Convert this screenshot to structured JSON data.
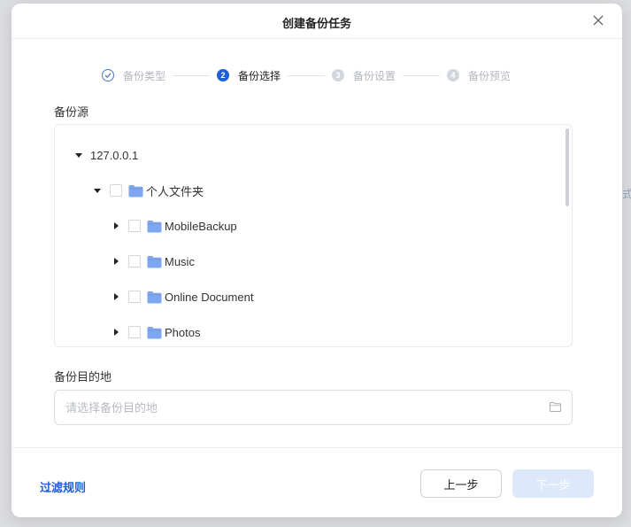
{
  "background": {
    "edge_text": "式"
  },
  "dialog": {
    "title": "创建备份任务",
    "close_icon": "close-icon"
  },
  "steps": [
    {
      "label": "备份类型",
      "state": "done",
      "marker": "check-icon"
    },
    {
      "label": "备份选择",
      "state": "active",
      "number": "2"
    },
    {
      "label": "备份设置",
      "state": "todo",
      "number": "3"
    },
    {
      "label": "备份预览",
      "state": "todo",
      "number": "4"
    }
  ],
  "source": {
    "label": "备份源",
    "tree": {
      "root": {
        "label": "127.0.0.1",
        "expanded": true
      },
      "folder": {
        "label": "个人文件夹",
        "expanded": true,
        "checked": false
      },
      "children": [
        {
          "label": "MobileBackup",
          "expanded": false,
          "checked": false
        },
        {
          "label": "Music",
          "expanded": false,
          "checked": false
        },
        {
          "label": "Online Document",
          "expanded": false,
          "checked": false
        },
        {
          "label": "Photos",
          "expanded": false,
          "checked": false
        }
      ]
    }
  },
  "destination": {
    "label": "备份目的地",
    "placeholder": "请选择备份目的地",
    "value": ""
  },
  "footer": {
    "filter_rules": "过滤规则",
    "prev_button": "上一步",
    "next_button": "下一步",
    "next_enabled": false
  },
  "colors": {
    "accent": "#1e5fd8",
    "folder": "#7fa6ee",
    "next_disabled_bg": "#dde8fb"
  }
}
